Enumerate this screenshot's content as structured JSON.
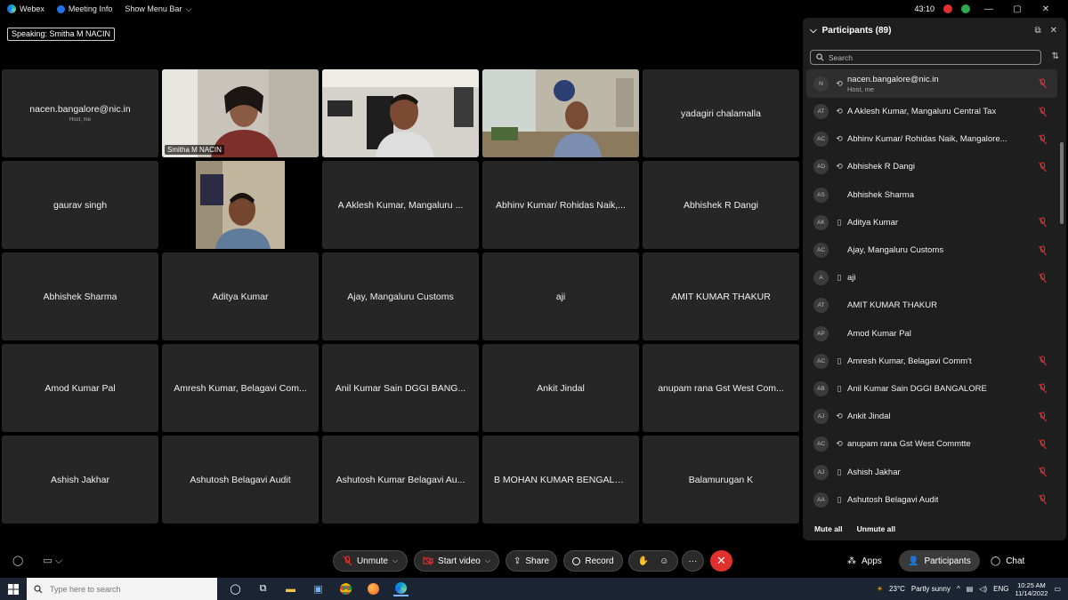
{
  "titlebar": {
    "app_name": "Webex",
    "meeting_info": "Meeting Info",
    "show_menu_bar": "Show Menu Bar",
    "timer": "43:10",
    "accent_color": "#00a0d1"
  },
  "speaking": {
    "label": "Speaking:",
    "name": "Smitha M NACIN"
  },
  "tiles": [
    {
      "name": "nacen.bangalore@nic.in",
      "sub": "Host, me",
      "video": false
    },
    {
      "name": "Smitha M NACIN",
      "video": true,
      "active": true
    },
    {
      "name": "",
      "video": true
    },
    {
      "name": "",
      "video": true
    },
    {
      "name": "yadagiri chalamalla",
      "video": false
    },
    {
      "name": "gaurav singh",
      "video": false
    },
    {
      "name": "",
      "video": true
    },
    {
      "name": "A Aklesh Kumar, Mangaluru ...",
      "video": false
    },
    {
      "name": "Abhinv Kumar/ Rohidas Naik,...",
      "video": false
    },
    {
      "name": "Abhishek R Dangi",
      "video": false
    },
    {
      "name": "Abhishek Sharma",
      "video": false
    },
    {
      "name": "Aditya Kumar",
      "video": false
    },
    {
      "name": "Ajay, Mangaluru Customs",
      "video": false
    },
    {
      "name": "aji",
      "video": false
    },
    {
      "name": "AMIT KUMAR THAKUR",
      "video": false
    },
    {
      "name": "Amod Kumar Pal",
      "video": false
    },
    {
      "name": "Amresh Kumar, Belagavi Com...",
      "video": false
    },
    {
      "name": "Anil Kumar Sain DGGI BANG...",
      "video": false
    },
    {
      "name": "Ankit Jindal",
      "video": false
    },
    {
      "name": "anupam rana Gst West Com...",
      "video": false
    },
    {
      "name": "Ashish Jakhar",
      "video": false
    },
    {
      "name": "Ashutosh Belagavi Audit",
      "video": false
    },
    {
      "name": "Ashutosh Kumar Belagavi Au...",
      "video": false
    },
    {
      "name": "B MOHAN KUMAR BENGALU...",
      "video": false
    },
    {
      "name": "Balamurugan K",
      "video": false
    }
  ],
  "participants": {
    "title": "Participants (89)",
    "search_placeholder": "Search",
    "list": [
      {
        "initials": "N",
        "name": "nacen.bangalore@nic.in",
        "role": "Host, me",
        "device": "sync",
        "muted": true,
        "host": true
      },
      {
        "initials": "AT",
        "name": "A Aklesh Kumar, Mangaluru Central Tax",
        "device": "sync",
        "muted": true
      },
      {
        "initials": "AC",
        "name": "Abhinv Kumar/ Rohidas Naik, Mangalore...",
        "device": "sync",
        "muted": true
      },
      {
        "initials": "AD",
        "name": "Abhishek R Dangi",
        "device": "sync",
        "muted": true
      },
      {
        "initials": "AS",
        "name": "Abhishek Sharma",
        "device": "",
        "muted": false
      },
      {
        "initials": "AK",
        "name": "Aditya Kumar",
        "device": "phone",
        "muted": true
      },
      {
        "initials": "AC",
        "name": "Ajay, Mangaluru Customs",
        "device": "",
        "muted": true
      },
      {
        "initials": "A",
        "name": "aji",
        "device": "phone",
        "muted": true
      },
      {
        "initials": "AT",
        "name": "AMIT KUMAR THAKUR",
        "device": "",
        "muted": false
      },
      {
        "initials": "AP",
        "name": "Amod Kumar Pal",
        "device": "",
        "muted": false
      },
      {
        "initials": "AC",
        "name": "Amresh Kumar, Belagavi Comm't",
        "device": "phone",
        "muted": true
      },
      {
        "initials": "AB",
        "name": "Anil Kumar Sain DGGI BANGALORE",
        "device": "phone",
        "muted": true
      },
      {
        "initials": "AJ",
        "name": "Ankit Jindal",
        "device": "sync",
        "muted": true
      },
      {
        "initials": "AC",
        "name": "anupam rana Gst West Commtte",
        "device": "sync",
        "muted": true
      },
      {
        "initials": "AJ",
        "name": "Ashish Jakhar",
        "device": "phone",
        "muted": true
      },
      {
        "initials": "AA",
        "name": "Ashutosh Belagavi Audit",
        "device": "phone",
        "muted": true
      }
    ],
    "mute_all": "Mute all",
    "unmute_all": "Unmute all"
  },
  "controls": {
    "unmute": "Unmute",
    "start_video": "Start video",
    "share": "Share",
    "record": "Record",
    "apps": "Apps",
    "participants": "Participants",
    "chat": "Chat",
    "muted_color": "#e0312e"
  },
  "taskbar": {
    "search_placeholder": "Type here to search",
    "temperature": "23°C",
    "weather": "Partly sunny",
    "lang": "ENG",
    "time": "10:25 AM",
    "date": "11/14/2022"
  }
}
